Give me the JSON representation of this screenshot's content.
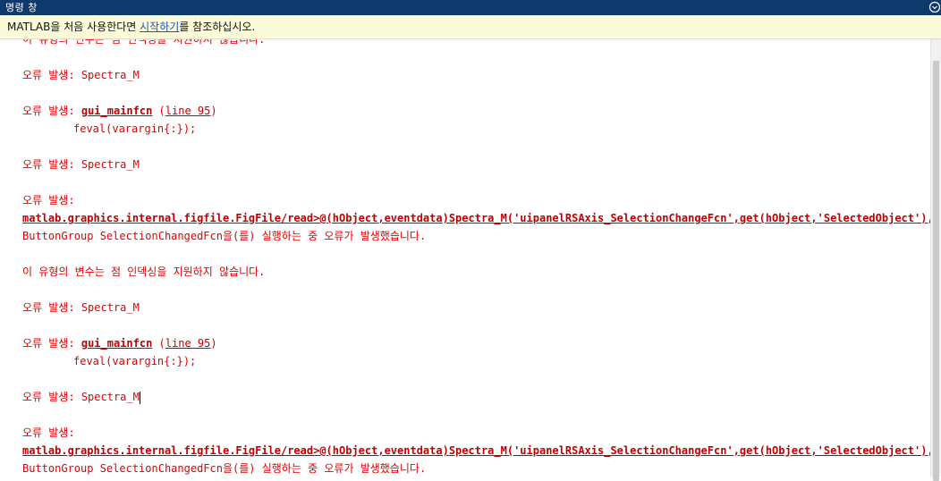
{
  "window": {
    "title": "명령 창",
    "menu_icon": "chevron-circle-icon"
  },
  "notice": {
    "prefix": "MATLAB을 처음 사용한다면 ",
    "link": "시작하기",
    "suffix": "를 참조하십시오."
  },
  "console": {
    "lines": [
      {
        "type": "text",
        "text": "이 유형의 변수는 점 인덱싱을 지원하지 않습니다."
      },
      {
        "type": "blank"
      },
      {
        "type": "text",
        "text": "오류 발생: Spectra_M"
      },
      {
        "type": "blank"
      },
      {
        "type": "link",
        "prefix": "오류 발생: ",
        "link": "gui_mainfcn",
        "mid": " (",
        "link2": "line 95",
        "suffix": ")"
      },
      {
        "type": "indent",
        "text": "feval(varargin{:});"
      },
      {
        "type": "blank"
      },
      {
        "type": "text",
        "text": "오류 발생: Spectra_M"
      },
      {
        "type": "blank"
      },
      {
        "type": "text",
        "text": "오류 발생:"
      },
      {
        "type": "boldlink",
        "text": "matlab.graphics.internal.figfile.FigFile/read>@(hObject,eventdata)Spectra_M('uipanelRSAxis_SelectionChangeFcn',get(hObject,'SelectedObject'),eventdata,guidata(hObject))"
      },
      {
        "type": "text",
        "text": "ButtonGroup SelectionChangedFcn을(를) 실행하는 중 오류가 발생했습니다."
      },
      {
        "type": "blank"
      },
      {
        "type": "text",
        "text": "이 유형의 변수는 점 인덱싱을 지원하지 않습니다."
      },
      {
        "type": "blank"
      },
      {
        "type": "text",
        "text": "오류 발생: Spectra_M"
      },
      {
        "type": "blank"
      },
      {
        "type": "link",
        "prefix": "오류 발생: ",
        "link": "gui_mainfcn",
        "mid": " (",
        "link2": "line 95",
        "suffix": ")"
      },
      {
        "type": "indent",
        "text": "feval(varargin{:});"
      },
      {
        "type": "blank"
      },
      {
        "type": "text",
        "text": "오류 발생: Spectra_M",
        "caret": true
      },
      {
        "type": "blank"
      },
      {
        "type": "text",
        "text": "오류 발생:"
      },
      {
        "type": "boldlink",
        "text": "matlab.graphics.internal.figfile.FigFile/read>@(hObject,eventdata)Spectra_M('uipanelRSAxis_SelectionChangeFcn',get(hObject,'SelectedObject'),eventdata,guidata(hObject))"
      },
      {
        "type": "text",
        "text": "ButtonGroup SelectionChangedFcn을(를) 실행하는 중 오류가 발생했습니다."
      }
    ]
  },
  "colors": {
    "titlebar": "#0f3a6e",
    "error_text": "#e10000",
    "notice_bg": "#fcfbd9",
    "link_blue": "#1a57c6"
  }
}
